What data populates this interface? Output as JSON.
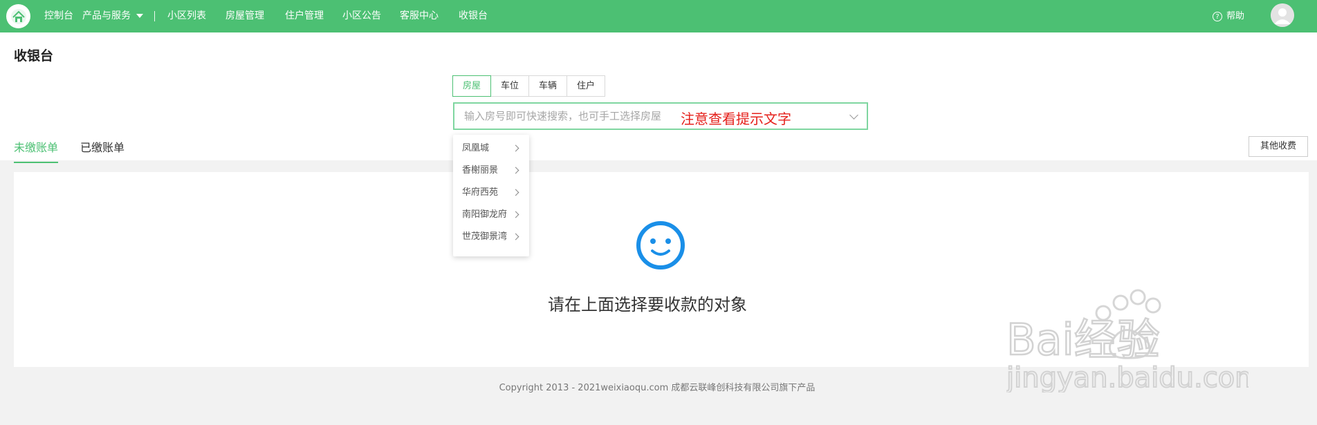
{
  "nav": {
    "items": [
      "控制台",
      "产品与服务",
      "小区列表",
      "房屋管理",
      "住户管理",
      "小区公告",
      "客服中心",
      "收银台"
    ],
    "help_label": "帮助"
  },
  "page": {
    "title": "收银台"
  },
  "segments": {
    "items": [
      "房屋",
      "车位",
      "车辆",
      "住户"
    ],
    "active_index": 0
  },
  "search": {
    "placeholder": "输入房号即可快速搜索，也可手工选择房屋",
    "value": "",
    "annotation": "注意查看提示文字"
  },
  "dropdown": {
    "items": [
      "凤凰城",
      "香榭丽景",
      "华府西苑",
      "南阳御龙府",
      "世茂御景湾"
    ]
  },
  "tabs": {
    "items": [
      "未缴账单",
      "已缴账单"
    ],
    "active_index": 0
  },
  "actions": {
    "other_fee_label": "其他收费"
  },
  "empty_state": {
    "message": "请在上面选择要收款的对象"
  },
  "footer": {
    "text": "Copyright 2013 - 2021weixiaoqu.com 成都云联峰创科技有限公司旗下产品"
  },
  "watermark": {
    "brand": "Bai经验",
    "domain": "jingyan.baidu.com"
  },
  "colors": {
    "brand": "#4cc073",
    "accent_blue": "#1a8fe8",
    "annotation_red": "#e5201b"
  }
}
